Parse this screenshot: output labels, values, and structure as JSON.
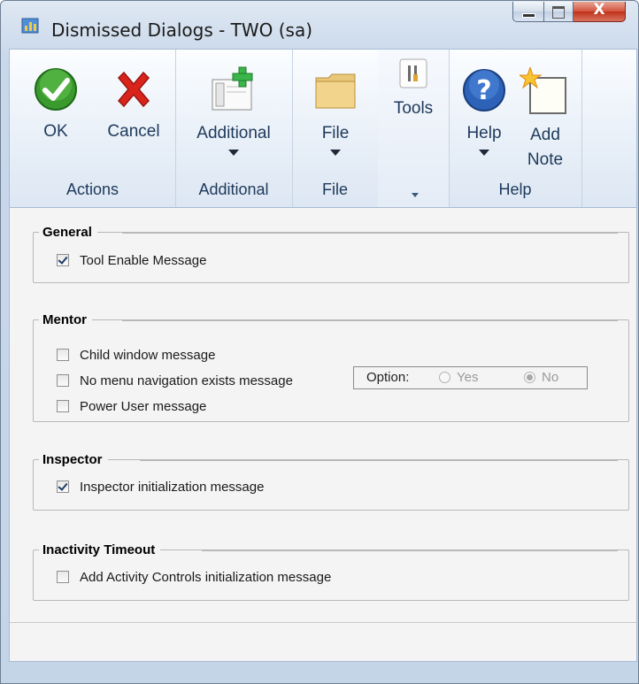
{
  "window": {
    "title": "Dismissed Dialogs  -  TWO (sa)",
    "controls": {
      "minimize": "minimize",
      "maximize": "maximize",
      "close": "X"
    }
  },
  "ribbon": {
    "groups": [
      {
        "label": "Actions",
        "buttons": [
          {
            "label": "OK",
            "icon": "ok-icon"
          },
          {
            "label": "Cancel",
            "icon": "cancel-icon"
          }
        ]
      },
      {
        "label": "Additional",
        "buttons": [
          {
            "label": "Additional",
            "icon": "additional-icon"
          }
        ]
      },
      {
        "label": "File",
        "buttons": [
          {
            "label": "File",
            "icon": "folder-icon"
          }
        ]
      },
      {
        "label": "",
        "buttons": [
          {
            "label": "Tools",
            "icon": "tools-icon"
          }
        ]
      },
      {
        "label": "Help",
        "buttons": [
          {
            "label": "Help",
            "icon": "help-icon"
          },
          {
            "label": "Add Note",
            "line1": "Add",
            "line2": "Note",
            "icon": "note-icon"
          }
        ]
      }
    ]
  },
  "sections": {
    "general": {
      "title": "General",
      "items": [
        {
          "label": "Tool Enable Message",
          "checked": true
        }
      ]
    },
    "mentor": {
      "title": "Mentor",
      "items": [
        {
          "label": "Child window message",
          "checked": false
        },
        {
          "label": "No menu navigation exists message",
          "checked": false
        },
        {
          "label": "Power User message",
          "checked": false
        }
      ],
      "option": {
        "label": "Option:",
        "yes": "Yes",
        "no": "No",
        "selected": "No"
      }
    },
    "inspector": {
      "title": "Inspector",
      "items": [
        {
          "label": "Inspector initialization message",
          "checked": true
        }
      ]
    },
    "inactivity": {
      "title": "Inactivity Timeout",
      "items": [
        {
          "label": "Add Activity Controls initialization message",
          "checked": false
        }
      ]
    }
  }
}
